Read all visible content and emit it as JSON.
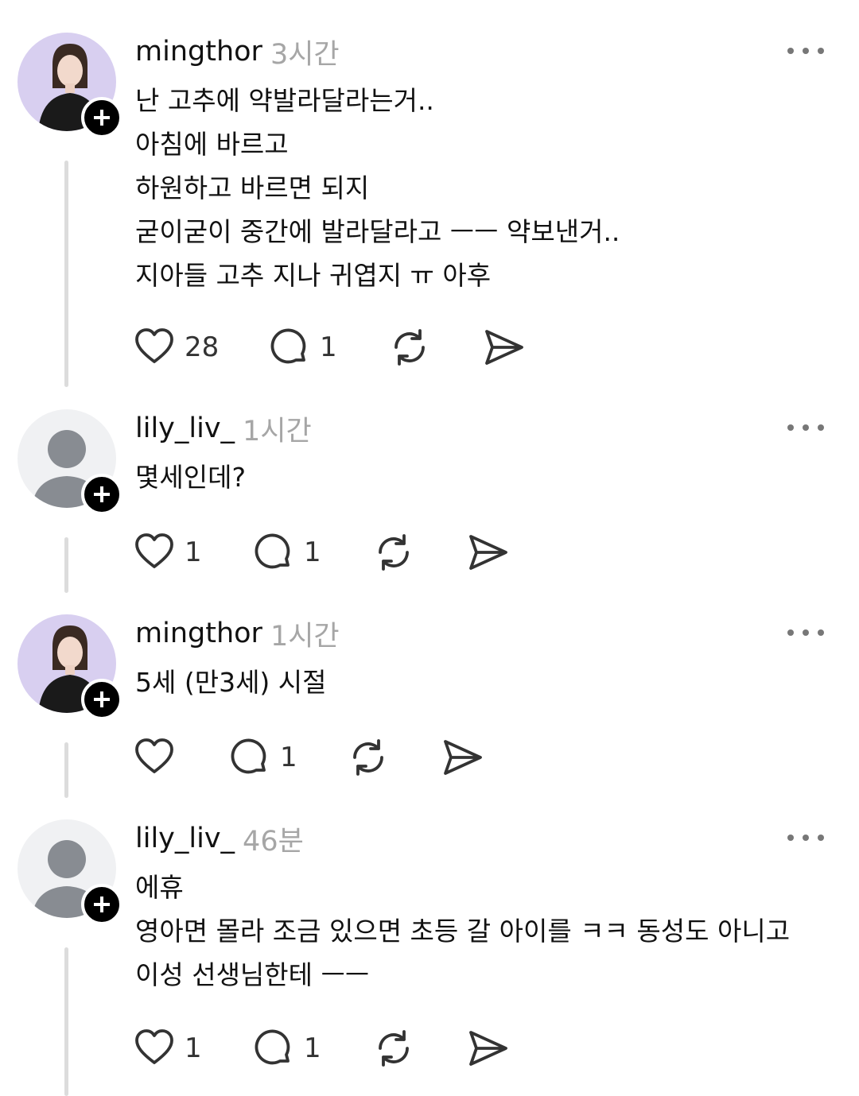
{
  "posts": [
    {
      "username": "mingthor",
      "time": "3시간",
      "avatar": "woman-photo-avatar",
      "lines": [
        "난 고추에 약발라달라는거..",
        "아침에 바르고",
        "하원하고 바르면 되지",
        "굳이굳이 중간에 발라달라고 ㅡㅡ 약보낸거..",
        "지아들 고추 지나 귀엽지 ㅠ 아후"
      ],
      "likes": "28",
      "replies": "1"
    },
    {
      "username": "lily_liv_",
      "time": "1시간",
      "avatar": "default-person-avatar",
      "lines": [
        "몇세인데?"
      ],
      "likes": "1",
      "replies": "1"
    },
    {
      "username": "mingthor",
      "time": "1시간",
      "avatar": "woman-photo-avatar",
      "lines": [
        "5세 (만3세) 시절"
      ],
      "likes": "",
      "replies": "1"
    },
    {
      "username": "lily_liv_",
      "time": "46분",
      "avatar": "default-person-avatar",
      "lines": [
        "에휴",
        "영아면 몰라 조금 있으면 초등 갈 아이를 ㅋㅋ 동성도 아니고",
        "이성 선생님한테 ㅡㅡ"
      ],
      "likes": "1",
      "replies": "1"
    }
  ],
  "icons": {
    "like": "heart-icon",
    "reply": "comment-icon",
    "repost": "repost-icon",
    "share": "send-icon",
    "more": "more-icon",
    "follow": "plus-icon"
  },
  "colors": {
    "text": "#111111",
    "muted": "#a6a6a6",
    "thread_line": "#dcdcdc",
    "icon": "#333333"
  }
}
